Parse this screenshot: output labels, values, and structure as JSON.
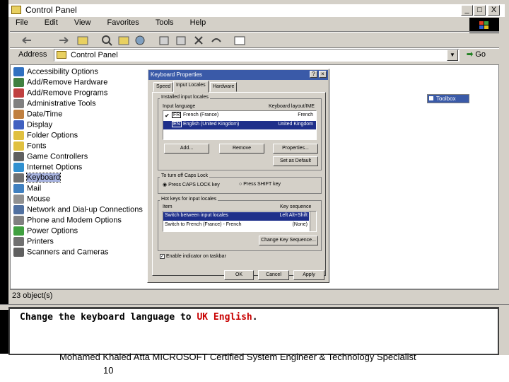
{
  "window": {
    "title": "Control Panel",
    "controls": [
      "_",
      "□",
      "X"
    ]
  },
  "menu": [
    {
      "label": "File"
    },
    {
      "label": "Edit"
    },
    {
      "label": "View"
    },
    {
      "label": "Favorites"
    },
    {
      "label": "Tools"
    },
    {
      "label": "Help"
    }
  ],
  "address": {
    "label": "Address",
    "value": "Control Panel",
    "go_label": "Go"
  },
  "items": [
    {
      "label": "Accessibility Options",
      "color": "#3070c0"
    },
    {
      "label": "Add/Remove Hardware",
      "color": "#408040"
    },
    {
      "label": "Add/Remove Programs",
      "color": "#c04040"
    },
    {
      "label": "Administrative Tools",
      "color": "#808080"
    },
    {
      "label": "Date/Time",
      "color": "#c08040"
    },
    {
      "label": "Display",
      "color": "#4060c0"
    },
    {
      "label": "Folder Options",
      "color": "#e0c040"
    },
    {
      "label": "Fonts",
      "color": "#e0c040"
    },
    {
      "label": "Game Controllers",
      "color": "#606060"
    },
    {
      "label": "Internet Options",
      "color": "#3090d0"
    },
    {
      "label": "Keyboard",
      "color": "#707070"
    },
    {
      "label": "Mail",
      "color": "#4080c0"
    },
    {
      "label": "Mouse",
      "color": "#909090"
    },
    {
      "label": "Network and Dial-up Connections",
      "color": "#5070a0"
    },
    {
      "label": "Phone and Modem Options",
      "color": "#808080"
    },
    {
      "label": "Power Options",
      "color": "#40a040"
    },
    {
      "label": "Printers",
      "color": "#707070"
    },
    {
      "label": "Scanners and Cameras",
      "color": "#606060"
    }
  ],
  "status": "23 object(s)",
  "toolbox": "Toolbox",
  "dialog": {
    "title": "Keyboard Properties",
    "tabs": [
      "Speed",
      "Input Locales",
      "Hardware"
    ],
    "installed_group": "Installed input locales",
    "col_input": "Input language",
    "col_layout": "Keyboard layout/IME",
    "locales": [
      {
        "code": "FR",
        "language": "French (France)",
        "layout": "French"
      },
      {
        "code": "EN",
        "language": "English (United Kingdom)",
        "layout": "United Kingdom"
      }
    ],
    "btn_add": "Add...",
    "btn_remove": "Remove",
    "btn_properties": "Properties...",
    "btn_default": "Set as Default",
    "caps_group": "To turn off Caps Lock",
    "caps_opt1": "Press CAPS LOCK key",
    "caps_opt2": "Press SHIFT key",
    "hotkey_group": "Hot keys for input locales",
    "col_item": "Item",
    "col_key": "Key sequence",
    "hotkeys": [
      {
        "item": "Switch between input locales",
        "key": "Left Alt+Shift"
      },
      {
        "item": "Switch to French (France) - French",
        "key": "(None)"
      }
    ],
    "btn_change": "Change Key Sequence...",
    "indicator": "Enable indicator on taskbar",
    "btn_ok": "OK",
    "btn_cancel": "Cancel",
    "btn_apply": "Apply"
  },
  "caption": {
    "prefix": "Change the keyboard language to ",
    "highlight": "UK English",
    "suffix": "."
  },
  "footer": "Mohamed Khaled Atta MICROSOFT Certified System Engineer & Technology Specialist",
  "page_number": "10"
}
